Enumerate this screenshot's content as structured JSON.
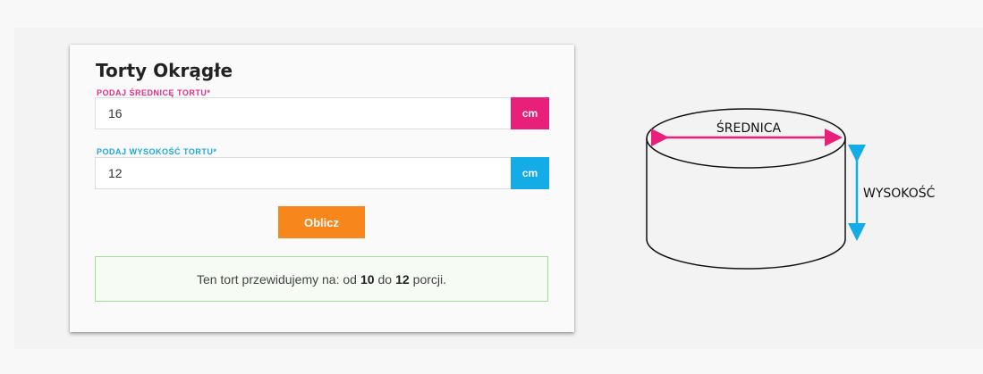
{
  "calculator": {
    "title": "Torty Okrągłe",
    "diameter": {
      "label": "PODAJ ŚREDNICĘ TORTU*",
      "value": "16",
      "unit": "cm"
    },
    "height": {
      "label": "PODAJ WYSOKOŚĆ TORTU*",
      "value": "12",
      "unit": "cm"
    },
    "button_label": "Oblicz",
    "result": {
      "prefix": "Ten tort przewidujemy na: od",
      "min": "10",
      "middle": "do",
      "max": "12",
      "suffix": "porcji."
    }
  },
  "diagram": {
    "diameter_label": "ŚREDNICA",
    "height_label": "WYSOKOŚĆ"
  },
  "colors": {
    "pink": "#e8207a",
    "blue": "#13ace6",
    "orange": "#f7861c",
    "result_border": "#a9d9a0"
  }
}
